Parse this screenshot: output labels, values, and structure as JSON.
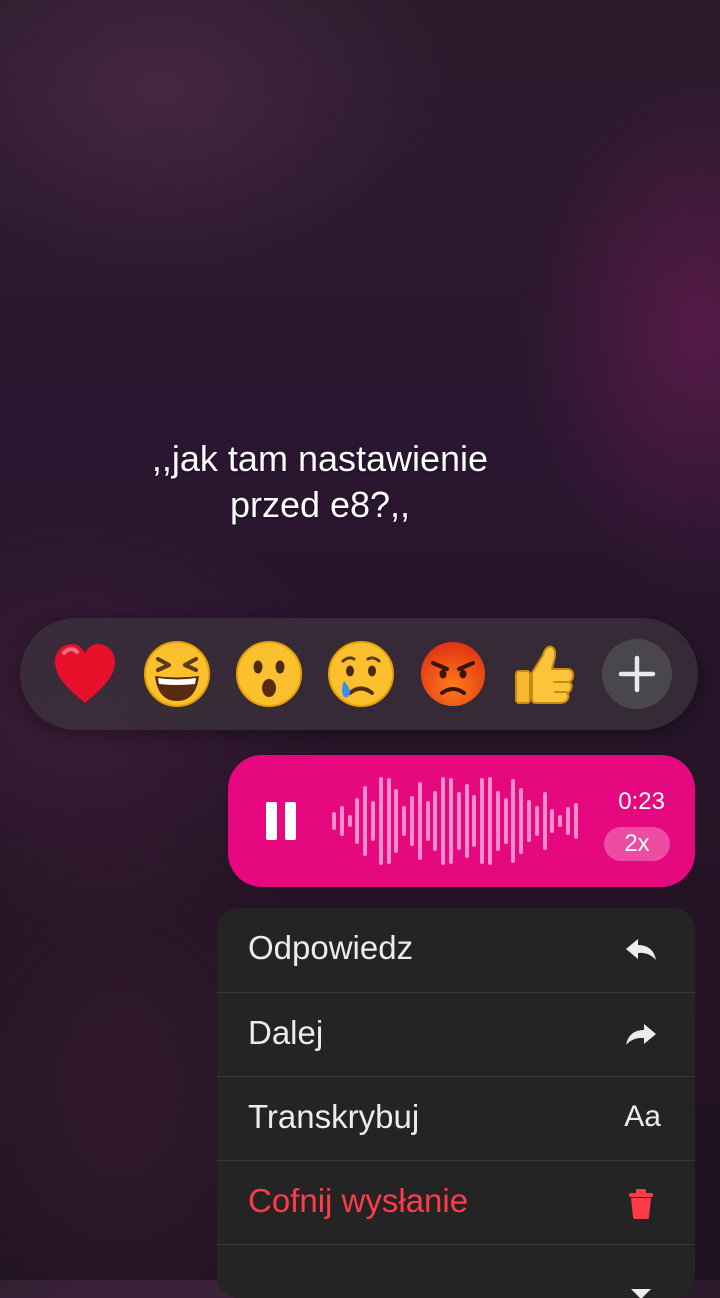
{
  "caption": {
    "line1": ",,jak tam nastawienie",
    "line2": "przed e8?,,"
  },
  "reactions": {
    "emojis": [
      {
        "name": "heart-emoji",
        "char": "❤️"
      },
      {
        "name": "laughing-emoji",
        "char": "😆"
      },
      {
        "name": "surprised-emoji",
        "char": "😮"
      },
      {
        "name": "crying-emoji",
        "char": "😢"
      },
      {
        "name": "angry-emoji",
        "char": "😡"
      },
      {
        "name": "thumbs-up-emoji",
        "char": "👍"
      }
    ],
    "more_icon": "plus-icon"
  },
  "voice_message": {
    "state_icon": "pause-icon",
    "duration": "0:23",
    "speed": "2x",
    "bubble_color": "#e5087e"
  },
  "menu": {
    "items": [
      {
        "label": "Odpowiedz",
        "icon": "reply-icon"
      },
      {
        "label": "Dalej",
        "icon": "forward-icon"
      },
      {
        "label": "Transkrybuj",
        "icon": "text-size-icon",
        "icon_text": "Aa"
      },
      {
        "label": "Cofnij wysłanie",
        "icon": "trash-icon",
        "color": "#ff3b4a"
      },
      {
        "label": "",
        "icon": "download-icon"
      }
    ]
  }
}
